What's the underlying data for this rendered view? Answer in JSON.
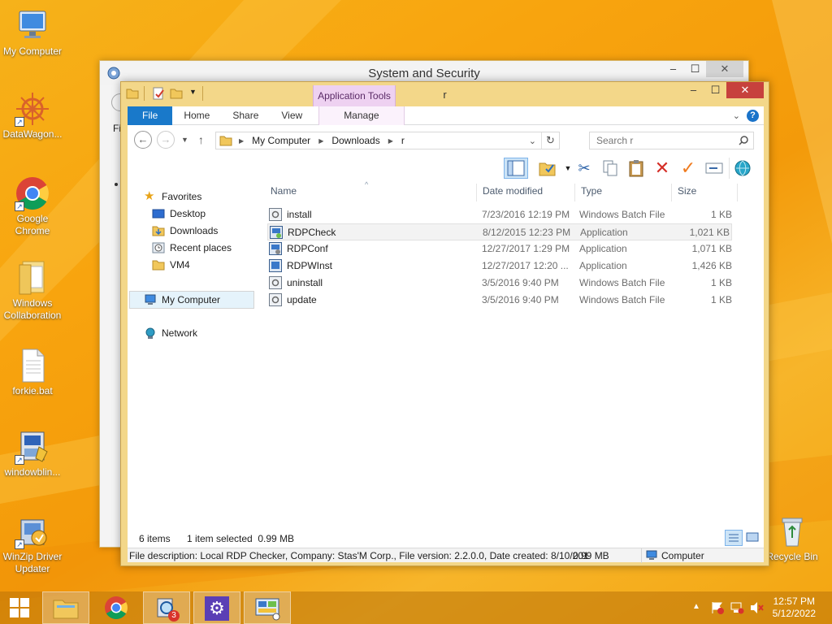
{
  "desktop": {
    "icons": [
      {
        "label": "My Computer"
      },
      {
        "label": "DataWagon..."
      },
      {
        "label": "Google Chrome"
      },
      {
        "label": "Windows Collaboration"
      },
      {
        "label": "forkie.bat"
      },
      {
        "label": "windowblin..."
      },
      {
        "label": "WinZip Driver Updater"
      },
      {
        "label": "Recycle Bin"
      }
    ]
  },
  "back_window": {
    "title": "System and Security",
    "controls": {
      "minimize": "–",
      "maximize": "☐",
      "close": "✕"
    },
    "partial_text": "Fi"
  },
  "window": {
    "title": "r",
    "context_tab_group": "Application Tools",
    "controls": {
      "minimize": "–",
      "maximize": "☐",
      "close": "✕"
    },
    "ribbon_tabs": [
      "File",
      "Home",
      "Share",
      "View",
      "Manage"
    ],
    "address": {
      "segments": [
        "My Computer",
        "Downloads",
        "r"
      ]
    },
    "search_placeholder": "Search r",
    "nav": {
      "favorites": "Favorites",
      "items": [
        "Desktop",
        "Downloads",
        "Recent places",
        "VM4"
      ],
      "computer": "My Computer",
      "network": "Network"
    },
    "columns": {
      "name": "Name",
      "date": "Date modified",
      "type": "Type",
      "size": "Size"
    },
    "files": [
      {
        "name": "install",
        "date": "7/23/2016 12:19 PM",
        "type": "Windows Batch File",
        "size": "1 KB"
      },
      {
        "name": "RDPCheck",
        "date": "8/12/2015 12:23 PM",
        "type": "Application",
        "size": "1,021 KB"
      },
      {
        "name": "RDPConf",
        "date": "12/27/2017 1:29 PM",
        "type": "Application",
        "size": "1,071 KB"
      },
      {
        "name": "RDPWInst",
        "date": "12/27/2017 12:20 ...",
        "type": "Application",
        "size": "1,426 KB"
      },
      {
        "name": "uninstall",
        "date": "3/5/2016 9:40 PM",
        "type": "Windows Batch File",
        "size": "1 KB"
      },
      {
        "name": "update",
        "date": "3/5/2016 9:40 PM",
        "type": "Windows Batch File",
        "size": "1 KB"
      }
    ],
    "status": {
      "items": "6 items",
      "selected": "1 item selected  0.99 MB"
    },
    "description": {
      "text": "File description: Local RDP Checker, Company: Stas'M Corp., File version: 2.2.0.0, Date created: 8/10/201",
      "size": "0.99 MB",
      "location": "Computer"
    }
  },
  "taskbar": {
    "badge": "3",
    "time": "12:57 PM",
    "date": "5/12/2022"
  },
  "colors": {
    "file_tab": "#1979ca",
    "close": "#c7413d",
    "context_tab": "#eed1f1"
  }
}
